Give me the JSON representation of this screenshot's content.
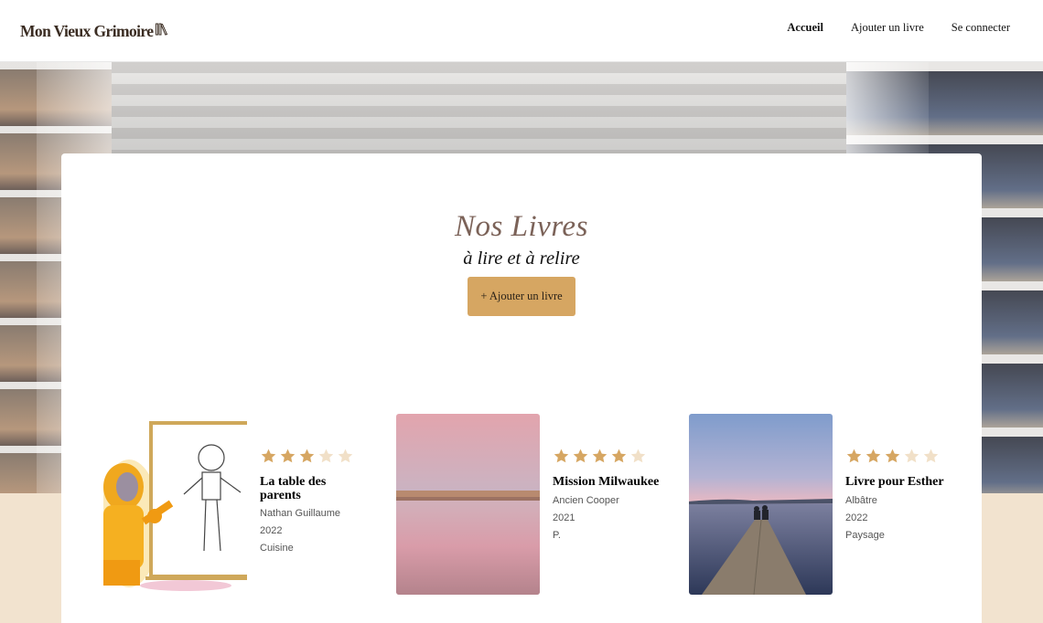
{
  "header": {
    "logo_text": "Mon Vieux Grimoire",
    "nav": [
      {
        "label": "Accueil",
        "active": true
      },
      {
        "label": "Ajouter un livre",
        "active": false
      },
      {
        "label": "Se connecter",
        "active": false
      }
    ]
  },
  "main": {
    "title": "Nos Livres",
    "subtitle": "à lire et à relire",
    "add_button_label": "+ Ajouter un livre"
  },
  "books": [
    {
      "title": "La table des parents",
      "author": "Nathan Guillaume",
      "year": "2022",
      "genre": "Cuisine",
      "rating": 3,
      "cover": "robot-drawing-illustration"
    },
    {
      "title": "Mission Milwaukee",
      "author": "Ancien Cooper",
      "year": "2021",
      "genre": "P.",
      "rating": 4,
      "cover": "pink-sunset-lake-photo"
    },
    {
      "title": "Livre pour Esther",
      "author": "Albâtre",
      "year": "2022",
      "genre": "Paysage",
      "rating": 3,
      "cover": "couple-on-pier-photo"
    }
  ],
  "colors": {
    "accent": "#d6a662",
    "star_filled": "#d6a662",
    "star_empty": "#f1e0c8",
    "title": "#7b6258",
    "beige_band": "#f2e3cf"
  },
  "icons": {
    "logo_mark": "books-icon",
    "star": "star-icon"
  }
}
